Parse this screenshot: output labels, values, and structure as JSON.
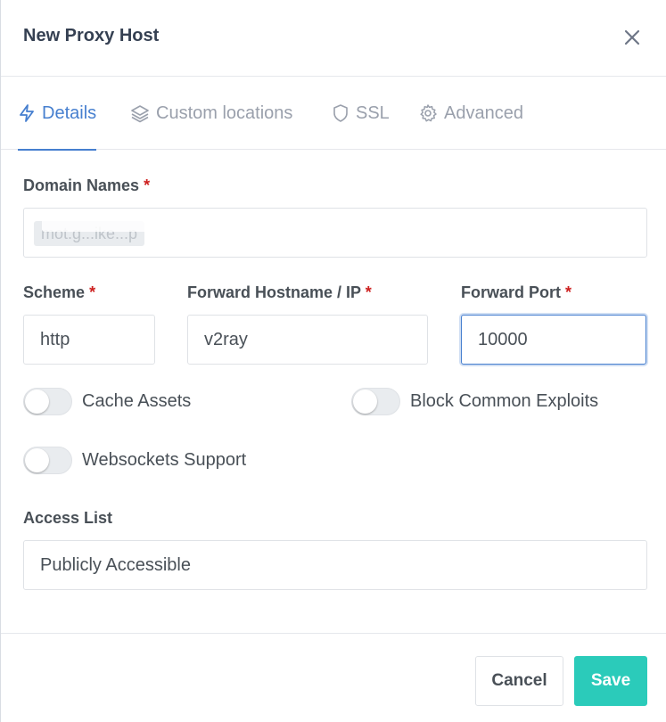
{
  "header": {
    "title": "New Proxy Host"
  },
  "tabs": [
    {
      "label": "Details",
      "icon": "lightning-icon",
      "active": true
    },
    {
      "label": "Custom locations",
      "icon": "layers-icon",
      "active": false
    },
    {
      "label": "SSL",
      "icon": "shield-icon",
      "active": false
    },
    {
      "label": "Advanced",
      "icon": "gear-icon",
      "active": false
    }
  ],
  "form": {
    "domain_names": {
      "label": "Domain Names",
      "required_mark": "*",
      "chip_text": "mot.g...ike...p"
    },
    "scheme": {
      "label": "Scheme",
      "required_mark": "*",
      "value": "http"
    },
    "forward_host": {
      "label": "Forward Hostname / IP",
      "required_mark": "*",
      "value": "v2ray"
    },
    "forward_port": {
      "label": "Forward Port",
      "required_mark": "*",
      "value": "10000"
    },
    "toggles": {
      "cache_assets": "Cache Assets",
      "block_exploits": "Block Common Exploits",
      "websockets": "Websockets Support"
    },
    "access_list": {
      "label": "Access List",
      "value": "Publicly Accessible"
    }
  },
  "footer": {
    "cancel_label": "Cancel",
    "save_label": "Save"
  },
  "colors": {
    "accent": "#467fcf",
    "save": "#2bcbba",
    "required": "#cd201f"
  }
}
